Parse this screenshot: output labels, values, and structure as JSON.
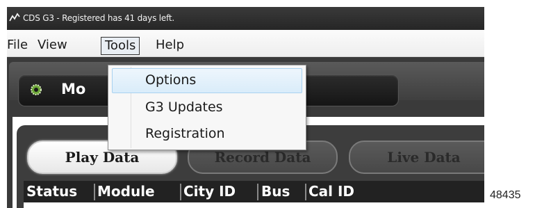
{
  "window": {
    "title": "CDS G3 - Registered has 41 days left."
  },
  "menubar": {
    "items": [
      "File",
      "View",
      "Tools",
      "Help"
    ],
    "active": "Tools"
  },
  "tools_menu": {
    "items": [
      "Options",
      "G3 Updates",
      "Registration"
    ],
    "highlighted": "Options"
  },
  "module_panel": {
    "label": "Mo"
  },
  "tabs": [
    {
      "label": "Play Data",
      "selected": true
    },
    {
      "label": "Record Data",
      "selected": false
    },
    {
      "label": "Live Data",
      "selected": false
    }
  ],
  "table": {
    "columns": [
      "Status",
      "Module",
      "City ID",
      "Bus",
      "Cal ID"
    ]
  },
  "figure_id": "48435",
  "colors": {
    "titlebar": "#2b2b2b",
    "highlight": "#d9ecfa",
    "highlight_border": "#a8d1f0",
    "header_row": "#222222"
  },
  "icons": {
    "app": "wave-logo-icon",
    "module": "gear-cog-icon"
  }
}
